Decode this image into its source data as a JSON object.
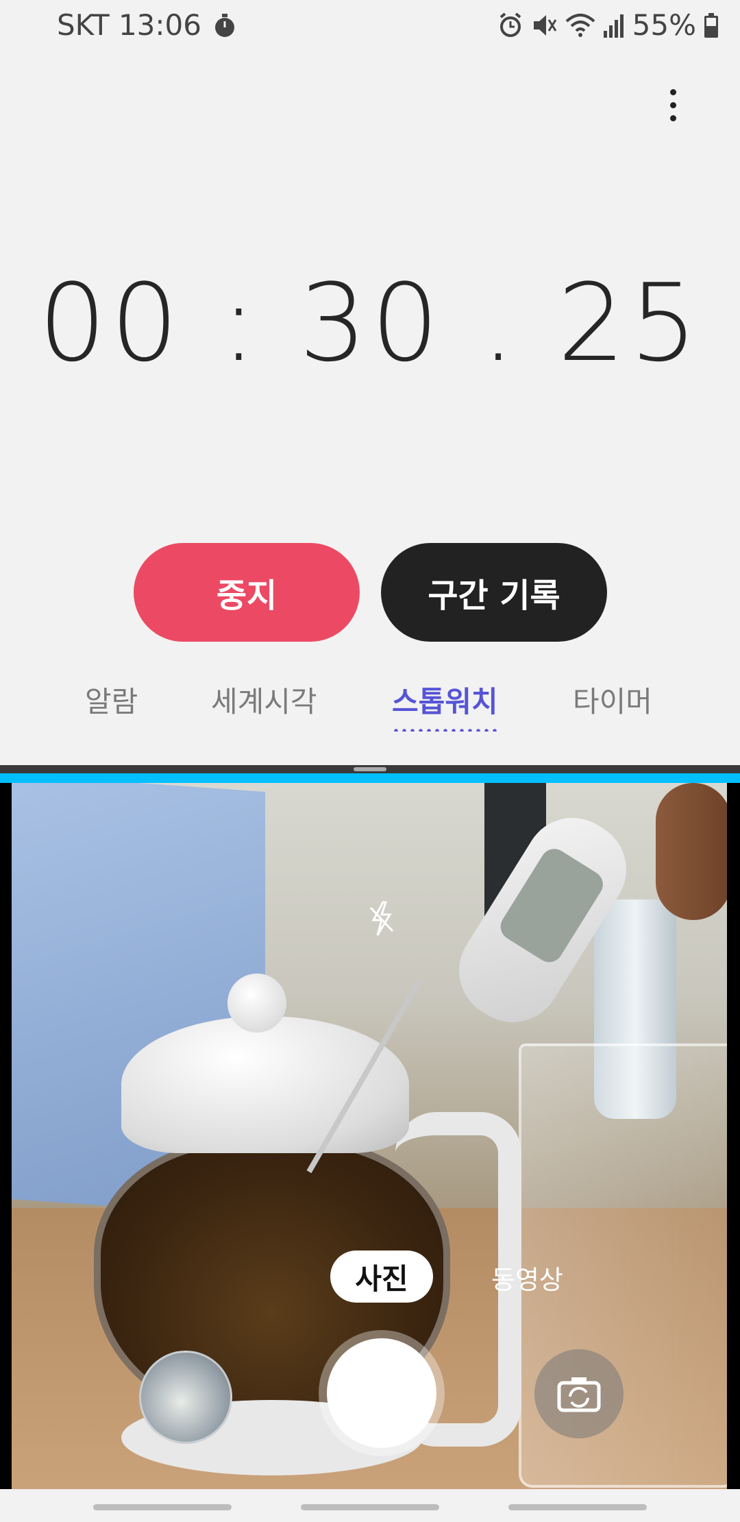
{
  "status_bar": {
    "carrier_time": "SKT 13:06",
    "battery": "55%",
    "icons": [
      "stopwatch-icon",
      "alarm-icon",
      "mute-icon",
      "wifi-icon",
      "signal-icon",
      "battery-icon"
    ]
  },
  "stopwatch": {
    "elapsed": "00 : 30 . 25",
    "stop_label": "중지",
    "lap_label": "구간 기록"
  },
  "tabs": [
    {
      "label": "알람",
      "active": false
    },
    {
      "label": "세계시각",
      "active": false
    },
    {
      "label": "스톱워치",
      "active": true
    },
    {
      "label": "타이머",
      "active": false
    }
  ],
  "camera": {
    "mode_photo": "사진",
    "mode_video": "동영상"
  },
  "colors": {
    "stop_button": "#ec4a64",
    "lap_button": "#222222",
    "active_tab": "#5654d6",
    "split_divider": "#00bfff"
  }
}
